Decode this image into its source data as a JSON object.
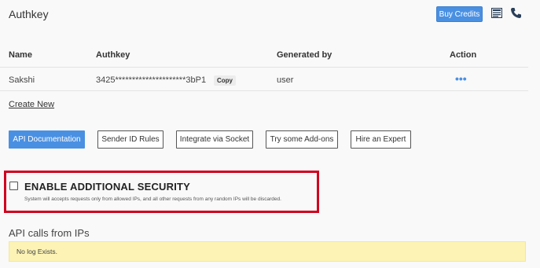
{
  "header": {
    "title": "Authkey",
    "buy_credits_label": "Buy Credits",
    "icons": [
      "document-icon",
      "phone-icon"
    ],
    "accent_color": "#4a90e2"
  },
  "table": {
    "columns": [
      "Name",
      "Authkey",
      "Generated by",
      "Action"
    ],
    "rows": [
      {
        "name": "Sakshi",
        "authkey": "3425*********************3bP1",
        "copy_label": "Copy",
        "generated_by": "user",
        "action": "•••"
      }
    ]
  },
  "create_new_label": "Create New",
  "buttons": {
    "api_docs": "API Documentation",
    "sender_id": "Sender ID Rules",
    "socket": "Integrate via Socket",
    "addons": "Try some Add-ons",
    "expert": "Hire an Expert"
  },
  "security": {
    "title": "ENABLE ADDITIONAL SECURITY",
    "description": "System will accepts requests only from allowed IPs, and all other requests from any random IPs will be discarded.",
    "checked": false,
    "highlight_color": "#d0021b"
  },
  "api_calls": {
    "title": "API calls from IPs",
    "empty_message": "No log Exists.",
    "notice_color": "#fcf3b5"
  }
}
